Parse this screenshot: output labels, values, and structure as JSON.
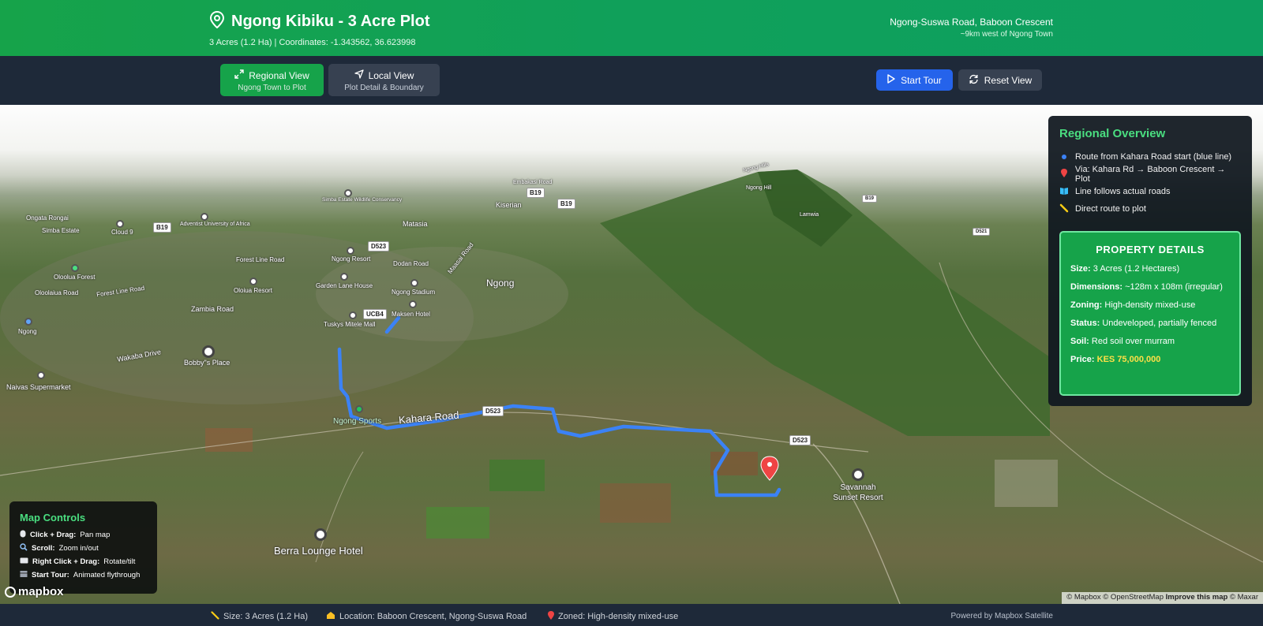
{
  "header": {
    "title": "Ngong Kibiku - 3 Acre Plot",
    "subtitle": "3 Acres (1.2 Ha) | Coordinates: -1.343562, 36.623998",
    "location_line1": "Ngong-Suswa Road, Baboon Crescent",
    "location_line2": "~9km west of Ngong Town",
    "icon": "map-pin-icon"
  },
  "toolbar": {
    "regional_label": "Regional View",
    "regional_sub": "Ngong Town to Plot",
    "local_label": "Local View",
    "local_sub": "Plot Detail & Boundary",
    "start_tour": "Start Tour",
    "reset_view": "Reset View"
  },
  "map": {
    "labels": {
      "ongata_rongai": "Ongata Rongai",
      "simba_estate": "Simba Estate",
      "cloud_9": "Cloud 9",
      "adventist_univ": "Adventist University of Africa",
      "kiserian": "Kiserian",
      "matasia": "Matasia",
      "forest_line_road": "Forest Line Road",
      "ngong_resort": "Ngong Resort",
      "dodan_road": "Dodan Road",
      "maasai_road": "Maasai Road",
      "oloolua_forest": "Oloolua Forest",
      "ooolaiua_road": "Oloolaiua Road",
      "forest_line_road2": "Forest Line Road",
      "oloiua_resort": "Oloiua Resort",
      "garden_lane": "Garden Lane House",
      "ngong_stadium": "Ngong Stadium",
      "ngong_town": "Ngong",
      "zambia_road": "Zambia Road",
      "tuskys": "Tuskys Mitele Mall",
      "maksen": "Maksen Hotel",
      "ngong_left": "Ngong",
      "wakaba": "Wakaba Drive",
      "bobbys": "Bobby\"s Place",
      "naivas": "Naivas Supermarket",
      "ngong_sports": "Ngong Sports",
      "kahara_road": "Kahara Road",
      "savannah": "Savannah Sunset Resort",
      "berra": "Berra Lounge Hotel",
      "ngong_hill": "Ngong Hill",
      "lamwia": "Lamwia",
      "ngong_hills": "Ngong Hills",
      "simba_estate_wildlife": "Simba Estate Wildlife Conservancy",
      "embakasi": "Embakasi Road"
    },
    "badges": {
      "b19a": "B19",
      "b19b": "B19",
      "b19c": "B19",
      "b19d": "B19",
      "d523a": "D523",
      "ucb4": "UCB4",
      "d523b": "D523",
      "d523c": "D523",
      "d521": "D521"
    },
    "logo": "mapbox",
    "attribution_a": "© Mapbox © OpenStreetMap",
    "attribution_b": "Improve this map",
    "attribution_c": "© Maxar"
  },
  "overview": {
    "title": "Regional Overview",
    "items": [
      {
        "icon": "blue-dot-icon",
        "text": "Route from Kahara Road start (blue line)"
      },
      {
        "icon": "red-pin-icon",
        "text": "Via: Kahara Rd → Baboon Crescent → Plot"
      },
      {
        "icon": "map-book-icon",
        "text": "Line follows actual roads"
      },
      {
        "icon": "ruler-icon",
        "text": "Direct route to plot"
      }
    ]
  },
  "property": {
    "title": "PROPERTY DETAILS",
    "size_label": "Size:",
    "size": "3 Acres (1.2 Hectares)",
    "dim_label": "Dimensions:",
    "dim": "~128m x 108m (irregular)",
    "zoning_label": "Zoning:",
    "zoning": "High-density mixed-use",
    "status_label": "Status:",
    "status": "Undeveloped, partially fenced",
    "soil_label": "Soil:",
    "soil": "Red soil over murram",
    "price_label": "Price:",
    "price": "KES 75,000,000"
  },
  "controls": {
    "title": "Map Controls",
    "rows": [
      {
        "key": "Click + Drag:",
        "val": "Pan map"
      },
      {
        "key": "Scroll:",
        "val": "Zoom in/out"
      },
      {
        "key": "Right Click + Drag:",
        "val": "Rotate/tilt"
      },
      {
        "key": "Start Tour:",
        "val": "Animated flythrough"
      }
    ]
  },
  "footer": {
    "size": "Size: 3 Acres (1.2 Ha)",
    "location": "Location: Baboon Crescent, Ngong-Suswa Road",
    "zoned": "Zoned: High-density mixed-use",
    "powered": "Powered by Mapbox Satellite"
  },
  "colors": {
    "header_green": "#16a34a",
    "route_blue": "#3b82f6",
    "accent_green": "#4ade80",
    "price_yellow": "#fde047",
    "tour_blue": "#2563eb"
  }
}
